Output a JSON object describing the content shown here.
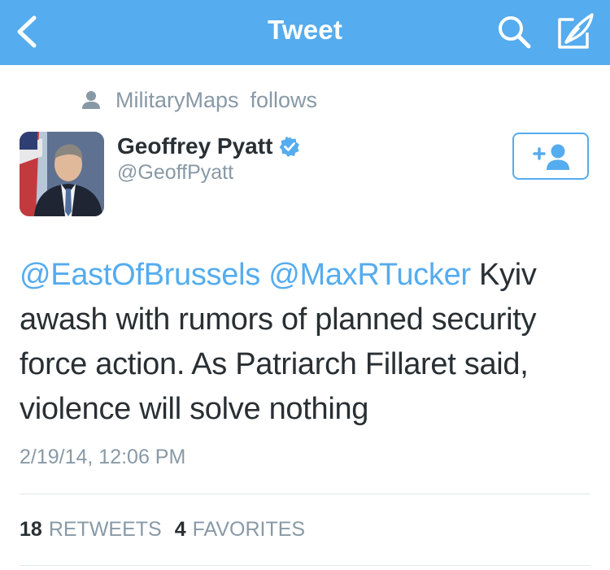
{
  "colors": {
    "nav_background": "#55acee",
    "link": "#55acee",
    "text": "#292f33",
    "muted": "#8899a6",
    "divider": "#e1e8ed"
  },
  "nav": {
    "title": "Tweet",
    "back_icon": "chevron-left-icon",
    "search_icon": "search-icon",
    "compose_icon": "compose-icon"
  },
  "context": {
    "icon": "person-icon",
    "user": "MilitaryMaps",
    "action": "follows"
  },
  "author": {
    "name": "Geoffrey Pyatt",
    "handle": "@GeoffPyatt",
    "verified_icon": "verified-badge-icon",
    "follow_icon": "add-user-icon"
  },
  "tweet": {
    "mention_1": "@EastOfBrussels",
    "mention_2": "@MaxRTucker",
    "body": "Kyiv awash with rumors of planned security force action. As Patriarch Fillaret said, violence will solve nothing",
    "timestamp": "2/19/14, 12:06 PM"
  },
  "stats": {
    "retweets_count": "18",
    "retweets_label": "RETWEETS",
    "favorites_count": "4",
    "favorites_label": "FAVORITES"
  }
}
